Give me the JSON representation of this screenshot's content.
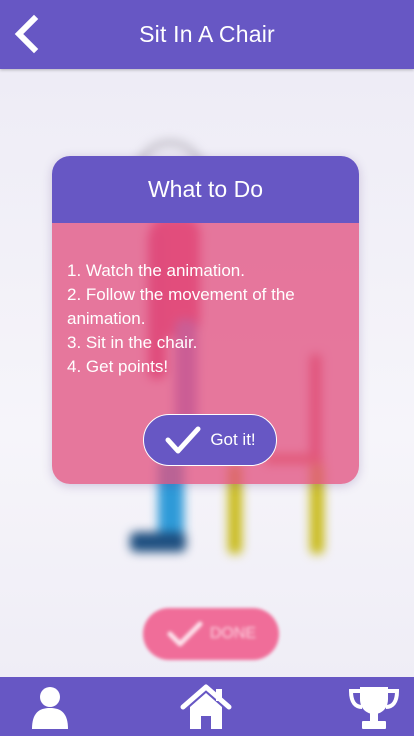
{
  "header": {
    "title": "Sit In A Chair",
    "back_icon": "chevron-left-icon"
  },
  "modal": {
    "title": "What to Do",
    "steps": [
      "1. Watch the animation.",
      "2. Follow the movement of the animation.",
      "3. Sit in the chair.",
      "4. Get points!"
    ],
    "button_label": "Got it!",
    "button_icon": "checkmark-icon"
  },
  "done_button": {
    "label": "DONE",
    "icon": "checkmark-icon"
  },
  "bottom_nav": {
    "items": [
      "profile-icon",
      "home-icon",
      "trophy-icon"
    ]
  },
  "colors": {
    "primary": "#6757c4",
    "accent_pink": "#e25381",
    "done_pink": "#f0608f"
  }
}
